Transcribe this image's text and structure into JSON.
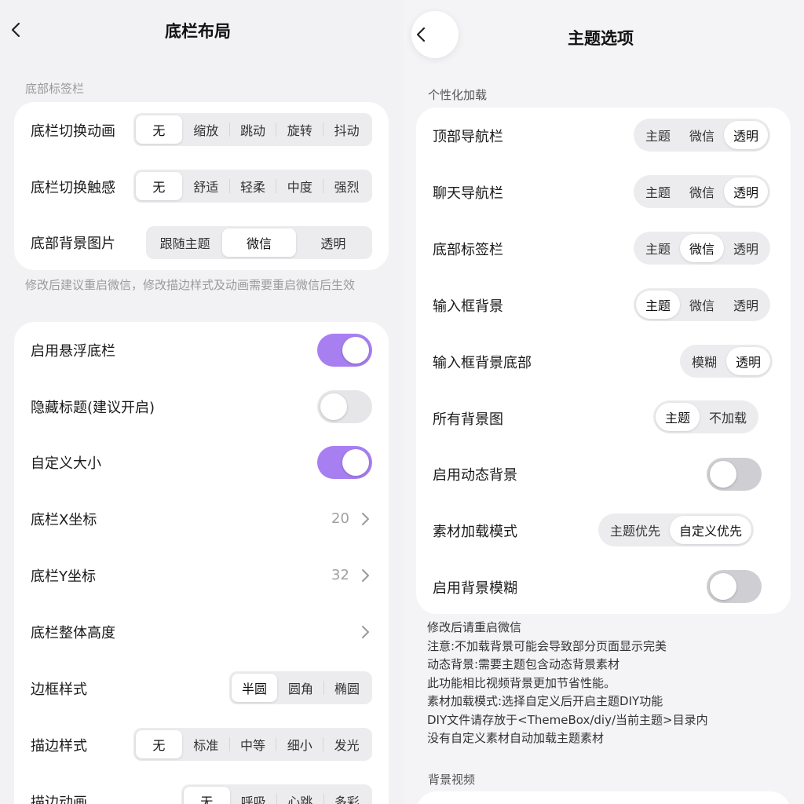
{
  "left": {
    "title": "底栏布局",
    "section_tabbar": "底部标签栏",
    "switch_anim": {
      "label": "底栏切换动画",
      "options": [
        "无",
        "缩放",
        "跳动",
        "旋转",
        "抖动"
      ],
      "selected": 0
    },
    "switch_haptic": {
      "label": "底栏切换触感",
      "options": [
        "无",
        "舒适",
        "轻柔",
        "中度",
        "强烈"
      ],
      "selected": 0
    },
    "bg_image": {
      "label": "底部背景图片",
      "options": [
        "跟随主题",
        "微信",
        "透明"
      ],
      "selected": 1
    },
    "note": "修改后建议重启微信，修改描边样式及动画需要重启微信后生效",
    "float_bar": {
      "label": "启用悬浮底栏",
      "on": true
    },
    "hide_title": {
      "label": "隐藏标题(建议开启)",
      "on": false
    },
    "custom_size": {
      "label": "自定义大小",
      "on": true
    },
    "x_coord": {
      "label": "底栏X坐标",
      "value": "20"
    },
    "y_coord": {
      "label": "底栏Y坐标",
      "value": "32"
    },
    "height": {
      "label": "底栏整体高度"
    },
    "border_style": {
      "label": "边框样式",
      "options": [
        "半圆",
        "圆角",
        "椭圆"
      ],
      "selected": 0
    },
    "stroke_style": {
      "label": "描边样式",
      "options": [
        "无",
        "标准",
        "中等",
        "细小",
        "发光"
      ],
      "selected": 0
    },
    "stroke_anim": {
      "label": "描边动画",
      "options": [
        "无",
        "呼吸",
        "心跳",
        "多彩"
      ],
      "selected": 0
    }
  },
  "right": {
    "title": "主题选项",
    "section_personal": "个性化加载",
    "top_nav": {
      "label": "顶部导航栏",
      "options": [
        "主题",
        "微信",
        "透明"
      ],
      "selected": 2
    },
    "chat_nav": {
      "label": "聊天导航栏",
      "options": [
        "主题",
        "微信",
        "透明"
      ],
      "selected": 2
    },
    "tab_bar": {
      "label": "底部标签栏",
      "options": [
        "主题",
        "微信",
        "透明"
      ],
      "selected": 1
    },
    "input_bg": {
      "label": "输入框背景",
      "options": [
        "主题",
        "微信",
        "透明"
      ],
      "selected": 0
    },
    "input_bg_bottom": {
      "label": "输入框背景底部",
      "options": [
        "模糊",
        "透明"
      ],
      "selected": 1
    },
    "all_bg": {
      "label": "所有背景图",
      "options": [
        "主题",
        "不加载"
      ],
      "selected": 0
    },
    "dynamic_bg": {
      "label": "启用动态背景",
      "on": false
    },
    "material_mode": {
      "label": "素材加载模式",
      "options": [
        "主题优先",
        "自定义优先"
      ],
      "selected": 1
    },
    "bg_blur": {
      "label": "启用背景模糊",
      "on": false
    },
    "notes": [
      "修改后请重启微信",
      "注意:不加载背景可能会导致部分页面显示完美",
      "动态背景:需要主题包含动态背景素材",
      "此功能相比视频背景更加节省性能。",
      "素材加载模式:选择自定义后开启主题DIY功能",
      "DIY文件请存放于<ThemeBox/diy/当前主题>目录内",
      "没有自定义素材自动加载主题素材"
    ],
    "section_video": "背景视频"
  },
  "colors": {
    "accent": "#a77ff0",
    "card": "#ffffff",
    "background": "#f2f2f4"
  }
}
